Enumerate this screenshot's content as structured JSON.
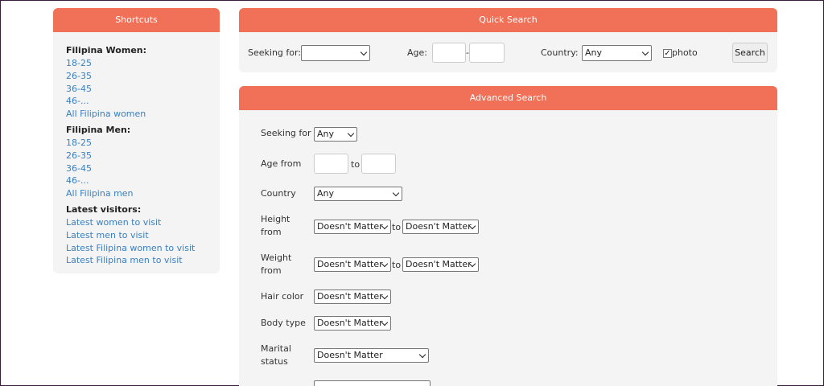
{
  "sidebar": {
    "title": "Shortcuts",
    "groups": [
      {
        "title": "Filipina Women:",
        "links": [
          "18-25",
          "26-35",
          "36-45",
          "46-...",
          "All Filipina women"
        ]
      },
      {
        "title": "Filipina Men:",
        "links": [
          "18-25",
          "26-35",
          "36-45",
          "46-...",
          "All Filipina men"
        ]
      },
      {
        "title": "Latest visitors:",
        "links": [
          "Latest women to visit",
          "Latest men to visit",
          "Latest Filipina women to visit",
          "Latest Filipina men to visit"
        ]
      }
    ]
  },
  "quick_search": {
    "title": "Quick Search",
    "seeking_label": "Seeking for:",
    "seeking_value": "",
    "age_label": "Age:",
    "age_separator": "-",
    "country_label": "Country:",
    "country_value": "Any",
    "photo_label": "photo",
    "photo_checked": true,
    "search_button": "Search"
  },
  "advanced_search": {
    "title": "Advanced Search",
    "seeking_label": "Seeking for",
    "seeking_value": "Any",
    "age_label": "Age from",
    "age_to": "to",
    "country_label": "Country",
    "country_value": "Any",
    "height_label_1": "Height",
    "height_label_2": "from",
    "height_from": "Doesn't Matter",
    "height_to_text": "to",
    "height_to": "Doesn't Matter",
    "weight_label_1": "Weight",
    "weight_label_2": "from",
    "weight_from": "Doesn't Matter",
    "weight_to_text": "to",
    "weight_to": "Doesn't Matter",
    "hair_label": "Hair color",
    "hair_value": "Doesn't Matter",
    "body_label": "Body type",
    "body_value": "Doesn't Matter",
    "marital_label_1": "Marital",
    "marital_label_2": "status",
    "marital_value": "Doesn't Matter"
  },
  "colors": {
    "header": "#f07058",
    "panel": "#f4f4f4",
    "link": "#3a7fc0"
  }
}
